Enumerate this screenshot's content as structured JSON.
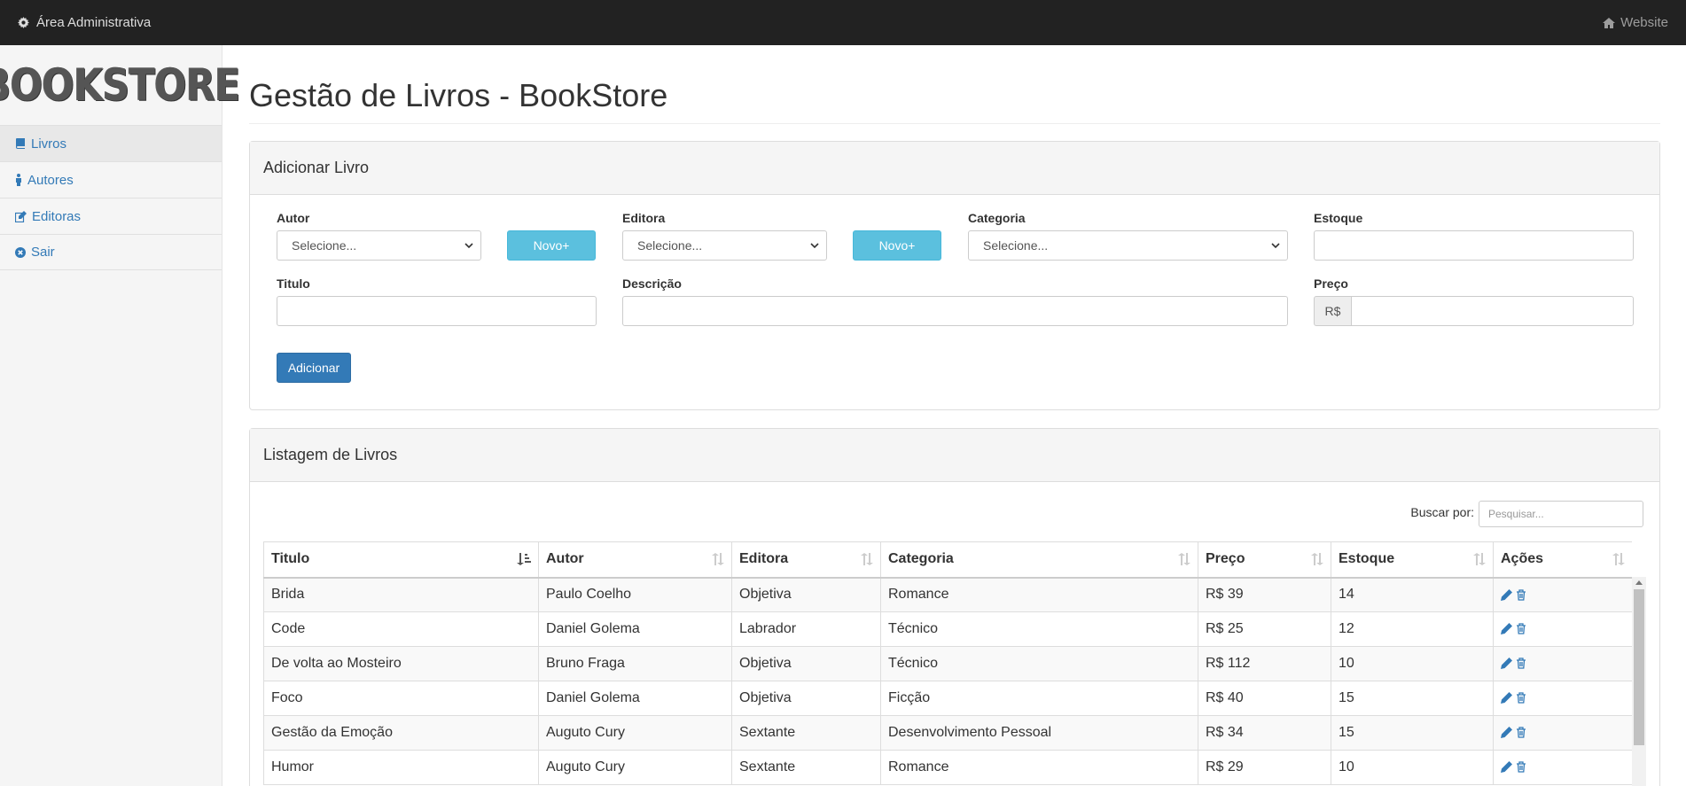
{
  "navbar": {
    "admin_label": "Área Administrativa",
    "website_label": "Website"
  },
  "sidebar": {
    "logo_text": "BOOKSTORE",
    "items": [
      {
        "label": "Livros",
        "icon": "book-icon",
        "active": true
      },
      {
        "label": "Autores",
        "icon": "person-icon",
        "active": false
      },
      {
        "label": "Editoras",
        "icon": "edit-icon",
        "active": false
      },
      {
        "label": "Sair",
        "icon": "close-circle-icon",
        "active": false
      }
    ]
  },
  "page": {
    "title": "Gestão de Livros - BookStore"
  },
  "form": {
    "heading": "Adicionar Livro",
    "autor_label": "Autor",
    "autor_value": "Selecione...",
    "novo_label": "Novo+",
    "editora_label": "Editora",
    "editora_value": "Selecione...",
    "categoria_label": "Categoria",
    "categoria_value": "Selecione...",
    "estoque_label": "Estoque",
    "titulo_label": "Titulo",
    "descricao_label": "Descrição",
    "preco_label": "Preço",
    "preco_addon": "R$",
    "submit_label": "Adicionar"
  },
  "listing": {
    "heading": "Listagem de Livros",
    "search_label": "Buscar por:",
    "search_placeholder": "Pesquisar...",
    "columns": [
      "Titulo",
      "Autor",
      "Editora",
      "Categoria",
      "Preço",
      "Estoque",
      "Ações"
    ],
    "rows": [
      [
        "Brida",
        "Paulo Coelho",
        "Objetiva",
        "Romance",
        "R$ 39",
        "14"
      ],
      [
        "Code",
        "Daniel Golema",
        "Labrador",
        "Técnico",
        "R$ 25",
        "12"
      ],
      [
        "De volta ao Mosteiro",
        "Bruno Fraga",
        "Objetiva",
        "Técnico",
        "R$ 112",
        "10"
      ],
      [
        "Foco",
        "Daniel Golema",
        "Objetiva",
        "Ficção",
        "R$ 40",
        "15"
      ],
      [
        "Gestão da Emoção",
        "Auguto Cury",
        "Sextante",
        "Desenvolvimento Pessoal",
        "R$ 34",
        "15"
      ],
      [
        "Humor",
        "Auguto Cury",
        "Sextante",
        "Romance",
        "R$ 29",
        "10"
      ]
    ]
  },
  "colors": {
    "navbar_bg": "#222222",
    "link": "#337ab7",
    "info": "#5bc0de",
    "primary": "#337ab7"
  }
}
